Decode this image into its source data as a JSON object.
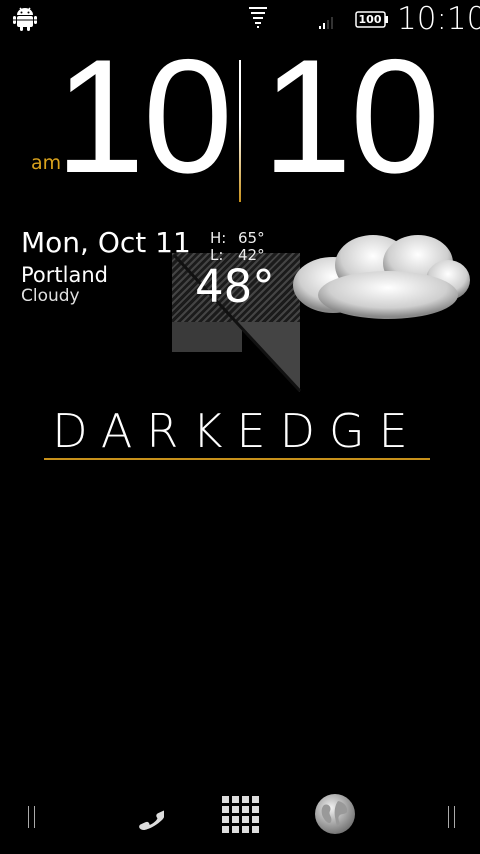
{
  "status_bar": {
    "time": "10:10",
    "battery": "100"
  },
  "clock": {
    "ampm": "am",
    "hours": "10",
    "minutes": "10"
  },
  "weather": {
    "date": "Mon, Oct 11",
    "city": "Portland",
    "condition": "Cloudy",
    "high_label": "H:",
    "high_value": "65°",
    "low_label": "L:",
    "low_value": "42°",
    "current_temp": "48°"
  },
  "brand": {
    "name": "DARKEDGE"
  },
  "dock": {
    "icons": [
      "phone-icon",
      "apps-icon",
      "globe-icon"
    ]
  },
  "colors": {
    "background": "#000000",
    "accent": "#c8911b",
    "text": "#ffffff"
  }
}
